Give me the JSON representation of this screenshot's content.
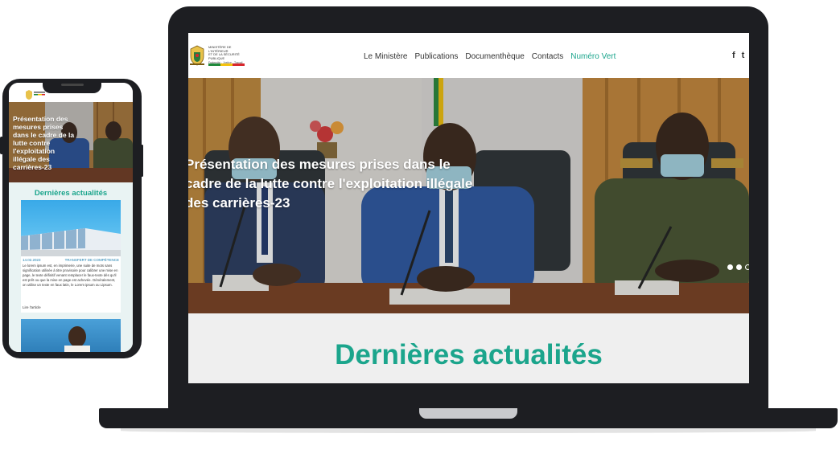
{
  "site": {
    "logo": {
      "title": "Ministère de l'Intérieur\net de la Sécurité Publique",
      "motto": "Fraternité - Justice - Travail",
      "flag_colors": [
        "#1f8a3b",
        "#f4c20d",
        "#d8262c"
      ]
    },
    "nav": [
      {
        "label": "Le Ministère"
      },
      {
        "label": "Publications"
      },
      {
        "label": "Documenthèque"
      },
      {
        "label": "Contacts"
      },
      {
        "label": "Numéro Vert"
      }
    ],
    "social": {
      "facebook": "f",
      "twitter": "t"
    },
    "hero": {
      "caption": "Présentation des mesures prises dans le cadre de la lutte contre l'exploitation illégale des carrières-23",
      "slide_count": 3,
      "active_slide": 1
    },
    "news_title": "Dernières actualités"
  },
  "mobile": {
    "hero_caption": "Présentation des mesures prises dans le cadre de la lutte contre l'exploitation illégale des carrières-23",
    "news_title": "Dernières actualités",
    "article": {
      "date": "14.02.2023",
      "category": "Transfert de compétence",
      "excerpt": "Le lorem ipsum est, en imprimerie, une suite de mots sans signification utilisée à titre provisoire pour calibrer une mise en page, le texte définitif venant remplacer le faux-texte dès qu'il est prêt ou que la mise en page est achevée. Généralement, on utilise un texte en faux latin, le Lorem ipsum ou Lipsum.",
      "read_more": "Lire l'article"
    }
  },
  "colors": {
    "accent": "#1ba58c",
    "device": "#1d1e22",
    "link": "#1b7fb0"
  }
}
